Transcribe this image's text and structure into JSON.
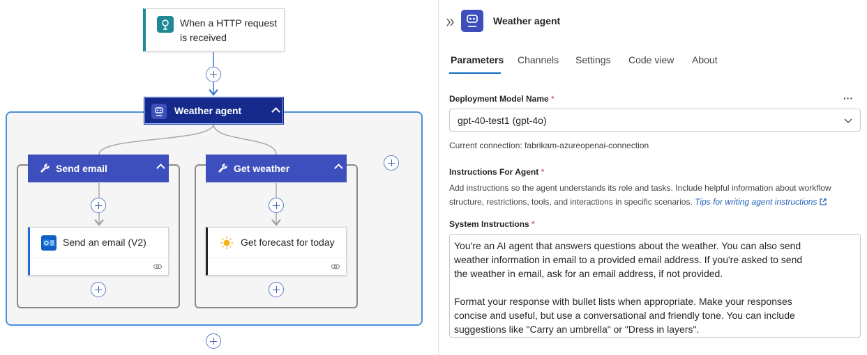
{
  "canvas": {
    "trigger": {
      "title": "When a HTTP request is received",
      "icon": "http-request-icon",
      "accent": "#1f8a96"
    },
    "agent": {
      "title": "Weather agent",
      "icon": "robot-icon",
      "color": "#152a8a"
    },
    "tools": [
      {
        "title": "Send email",
        "icon": "wrench-icon",
        "action": {
          "title": "Send an email (V2)",
          "icon": "outlook-icon",
          "accent": "#1e6bd6"
        }
      },
      {
        "title": "Get weather",
        "icon": "wrench-icon",
        "action": {
          "title": "Get forecast for today",
          "icon": "sun-icon",
          "accent": "#242424"
        }
      }
    ],
    "tool_header_color": "#3d4fbc",
    "scope_border_color": "#4a90d9"
  },
  "panel": {
    "title": "Weather agent",
    "tabs": [
      {
        "label": "Parameters",
        "active": true
      },
      {
        "label": "Channels"
      },
      {
        "label": "Settings"
      },
      {
        "label": "Code view"
      },
      {
        "label": "About"
      }
    ],
    "deployment": {
      "label": "Deployment Model Name",
      "required": "*",
      "value": "gpt-40-test1 (gpt-4o)",
      "more": "···"
    },
    "connection": "Current connection: fabrikam-azureopenai-connection",
    "instructions": {
      "label": "Instructions For Agent",
      "required": "*",
      "help_line1": "Add instructions so the agent understands its role and tasks. Include helpful information about workflow",
      "help_line2": "structure, restrictions, tools, and interactions in specific scenarios.",
      "link": "Tips for writing agent instructions"
    },
    "system": {
      "label": "System Instructions",
      "required": "*",
      "lines": [
        "You're an AI agent that answers questions about the weather. You can also send",
        "weather information in email to a provided email address. If you're asked to send",
        "the weather in email, ask for an email address, if not provided.",
        "",
        "Format your response with bullet lists when appropriate. Make your responses",
        "concise and useful, but use a conversational and friendly tone. You can include",
        "suggestions like \"Carry an umbrella\" or \"Dress in layers\"."
      ]
    }
  }
}
